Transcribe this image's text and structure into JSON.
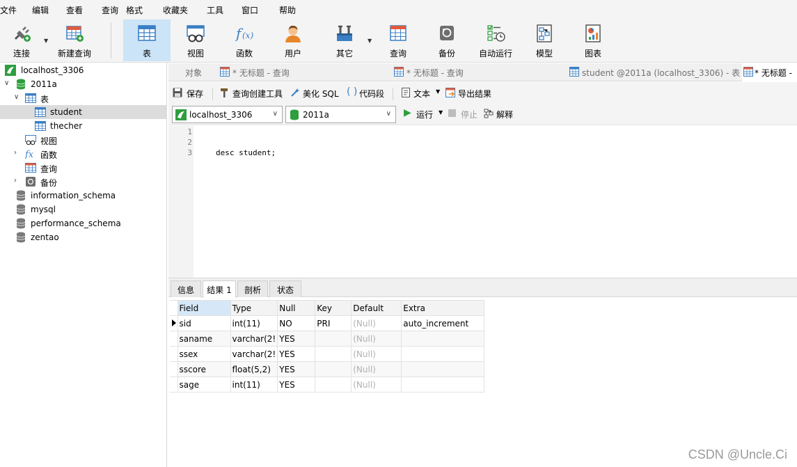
{
  "menu": [
    "文件",
    "编辑",
    "查看",
    "查询",
    "格式",
    "收藏夹",
    "工具",
    "窗口",
    "帮助"
  ],
  "toolbar": {
    "connect": "连接",
    "new_query": "新建查询",
    "table": "表",
    "view": "视图",
    "function": "函数",
    "user": "用户",
    "other": "其它",
    "query": "查询",
    "backup": "备份",
    "auto_run": "自动运行",
    "model": "模型",
    "chart": "图表"
  },
  "tree": {
    "connection": "localhost_3306",
    "database": "2011a",
    "tables_folder": "表",
    "table_student": "student",
    "table_thecher": "thecher",
    "views_folder": "视图",
    "functions_folder": "函数",
    "queries_folder": "查询",
    "backups_folder": "备份",
    "db_information_schema": "information_schema",
    "db_mysql": "mysql",
    "db_performance_schema": "performance_schema",
    "db_zentao": "zentao"
  },
  "tabs": {
    "objects": "对象",
    "untitled_query_1": "* 无标题 - 查询",
    "untitled_query_2": "* 无标题 - 查询",
    "student_table": "student @2011a (localhost_3306) - 表",
    "untitled_query_active": "* 无标题 -"
  },
  "editor_toolbar": {
    "save": "保存",
    "query_builder": "查询创建工具",
    "beautify": "美化 SQL",
    "snippet": "代码段",
    "text": "文本",
    "export": "导出结果"
  },
  "connection_bar": {
    "connection": "localhost_3306",
    "database": "2011a",
    "run": "运行",
    "stop": "停止",
    "explain": "解释"
  },
  "editor": {
    "line_numbers": [
      "1",
      "2",
      "3"
    ],
    "line3": "desc student;"
  },
  "result_tabs": {
    "info": "信息",
    "result1": "结果 1",
    "profile": "剖析",
    "status": "状态"
  },
  "result_grid": {
    "columns": [
      "Field",
      "Type",
      "Null",
      "Key",
      "Default",
      "Extra"
    ],
    "rows": [
      [
        "sid",
        "int(11)",
        "NO",
        "PRI",
        "(Null)",
        "auto_increment"
      ],
      [
        "saname",
        "varchar(2!",
        "YES",
        "",
        "(Null)",
        ""
      ],
      [
        "ssex",
        "varchar(2!",
        "YES",
        "",
        "(Null)",
        ""
      ],
      [
        "sscore",
        "float(5,2)",
        "YES",
        "",
        "(Null)",
        ""
      ],
      [
        "sage",
        "int(11)",
        "YES",
        "",
        "(Null)",
        ""
      ]
    ]
  },
  "watermark": "CSDN @Uncle.Ci",
  "colors": {
    "selected_tool": "#cce4f7",
    "db_green": "#2e9e3e",
    "table_blue": "#3a7fc4",
    "null_gray": "#b0b0b0"
  }
}
